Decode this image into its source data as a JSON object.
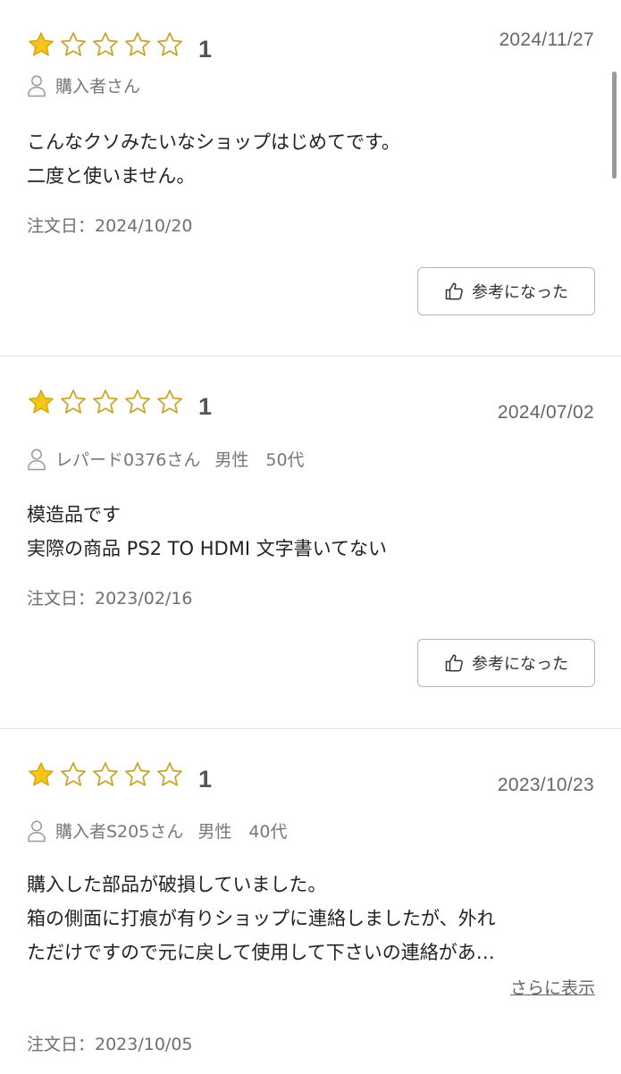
{
  "colors": {
    "star_filled": "#f5c518",
    "star_outline": "#c9a227",
    "text_main": "#222222",
    "text_muted": "#777777",
    "divider": "#e3e3e3"
  },
  "reviews": [
    {
      "rating": 1,
      "rating_label": "1",
      "date": "2024/11/27",
      "reviewer": "購入者さん",
      "reviewer_meta": "",
      "body_lines": [
        "こんなクソみたいなショップはじめてです。",
        "二度と使いません。"
      ],
      "order_date": "注文日：2024/10/20",
      "helpful_label": "参考になった",
      "more_label": ""
    },
    {
      "rating": 1,
      "rating_label": "1",
      "date": "2024/07/02",
      "reviewer": "レパード0376さん",
      "reviewer_meta": "男性　50代",
      "body_lines": [
        "模造品です",
        "実際の商品 PS2 TO HDMI 文字書いてない"
      ],
      "order_date": "注文日：2023/02/16",
      "helpful_label": "参考になった",
      "more_label": ""
    },
    {
      "rating": 1,
      "rating_label": "1",
      "date": "2023/10/23",
      "reviewer": "購入者S205さん",
      "reviewer_meta": "男性　40代",
      "body_lines": [
        "購入した部品が破損していました。",
        "箱の側面に打痕が有りショップに連絡しましたが、外れ",
        "ただけですので元に戻して使用して下さいの連絡があ…"
      ],
      "order_date": "注文日：2023/10/05",
      "helpful_label": "",
      "more_label": "さらに表示"
    }
  ],
  "icons": {
    "star": "star-icon",
    "person": "person-icon",
    "thumb": "thumbs-up-icon"
  }
}
